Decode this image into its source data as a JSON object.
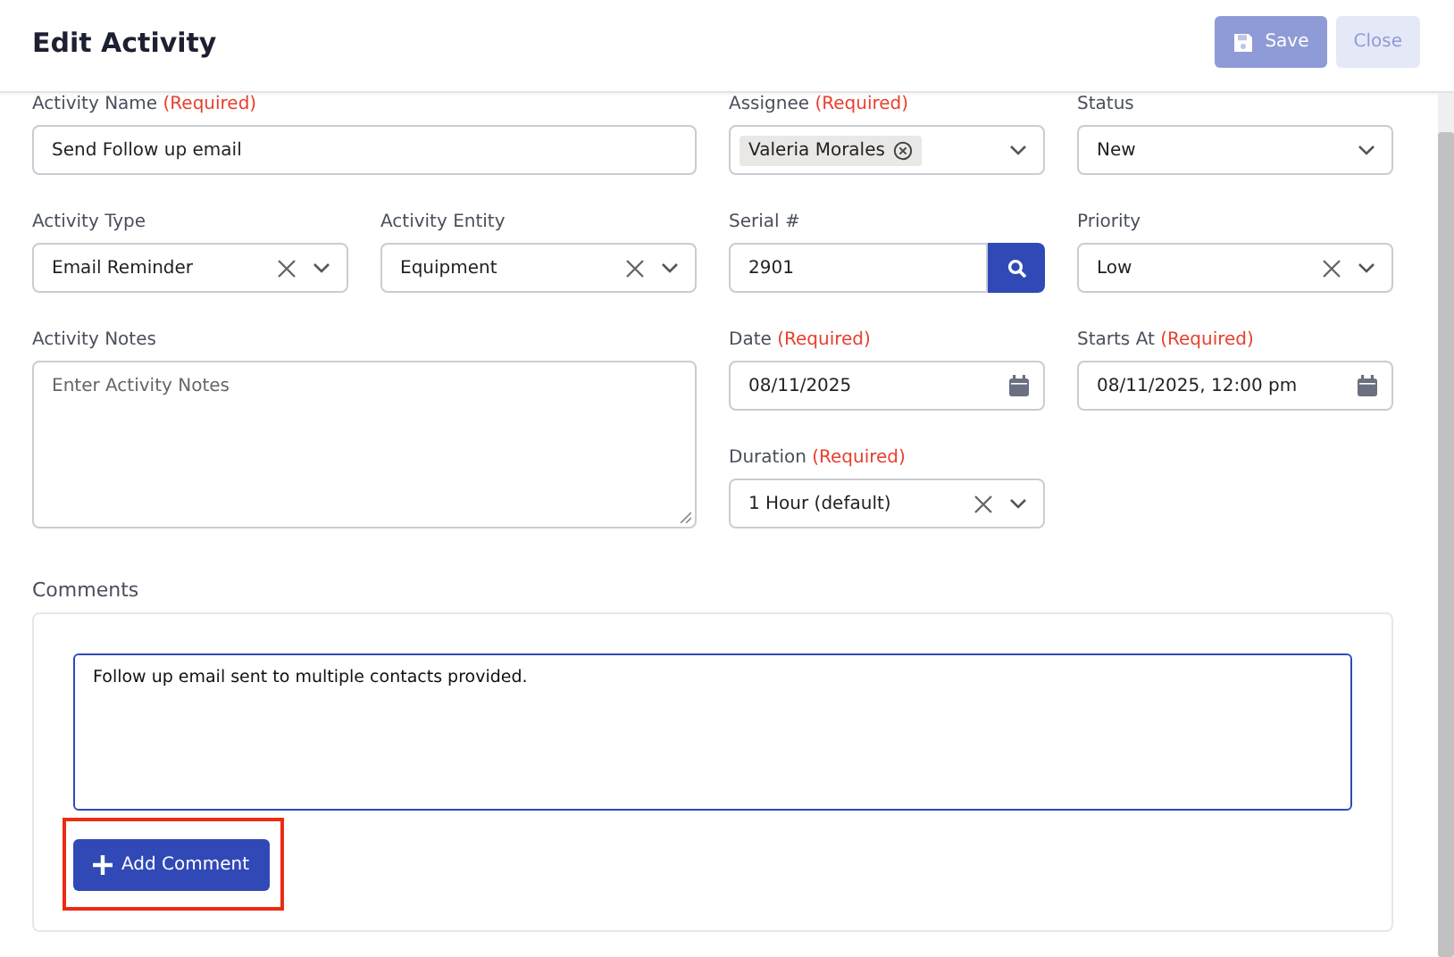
{
  "header": {
    "title": "Edit Activity",
    "buttons": [
      {
        "label": "Save",
        "kind": "primary",
        "disabled": true
      },
      {
        "label": "Close",
        "kind": "secondary",
        "disabled": true
      }
    ]
  },
  "fields": [
    {
      "kind": "text",
      "label": "Activity Name",
      "required_note": "(Required)",
      "value": "Send Follow up email"
    },
    {
      "kind": "tags",
      "label": "Assignee",
      "required_note": "(Required)",
      "tags": [
        "Valeria Morales"
      ]
    },
    {
      "kind": "select",
      "label": "Status",
      "value": "New",
      "clearable": false
    },
    {
      "kind": "select",
      "label": "Activity Type",
      "value": "Email Reminder",
      "clearable": true
    },
    {
      "kind": "select",
      "label": "Activity Entity",
      "value": "Equipment",
      "clearable": true
    },
    {
      "kind": "search",
      "label": "Serial #",
      "value": "2901"
    },
    {
      "kind": "select",
      "label": "Priority",
      "value": "Low",
      "clearable": true
    },
    {
      "kind": "textarea",
      "label": "Activity Notes",
      "placeholder": "Enter Activity Notes"
    },
    {
      "kind": "date",
      "label": "Date",
      "required_note": "(Required)",
      "value": "08/11/2025"
    },
    {
      "kind": "date",
      "label": "Starts At",
      "required_note": "(Required)",
      "value": "08/11/2025, 12:00 pm"
    },
    {
      "kind": "select",
      "label": "Duration",
      "required_note": "(Required)",
      "value": "1 Hour (default)",
      "clearable": true
    }
  ],
  "comments": {
    "label": "Comments",
    "draft": "Follow up email sent to multiple contacts provided.",
    "button": {
      "label": "Add Comment",
      "highlighted": true
    }
  }
}
